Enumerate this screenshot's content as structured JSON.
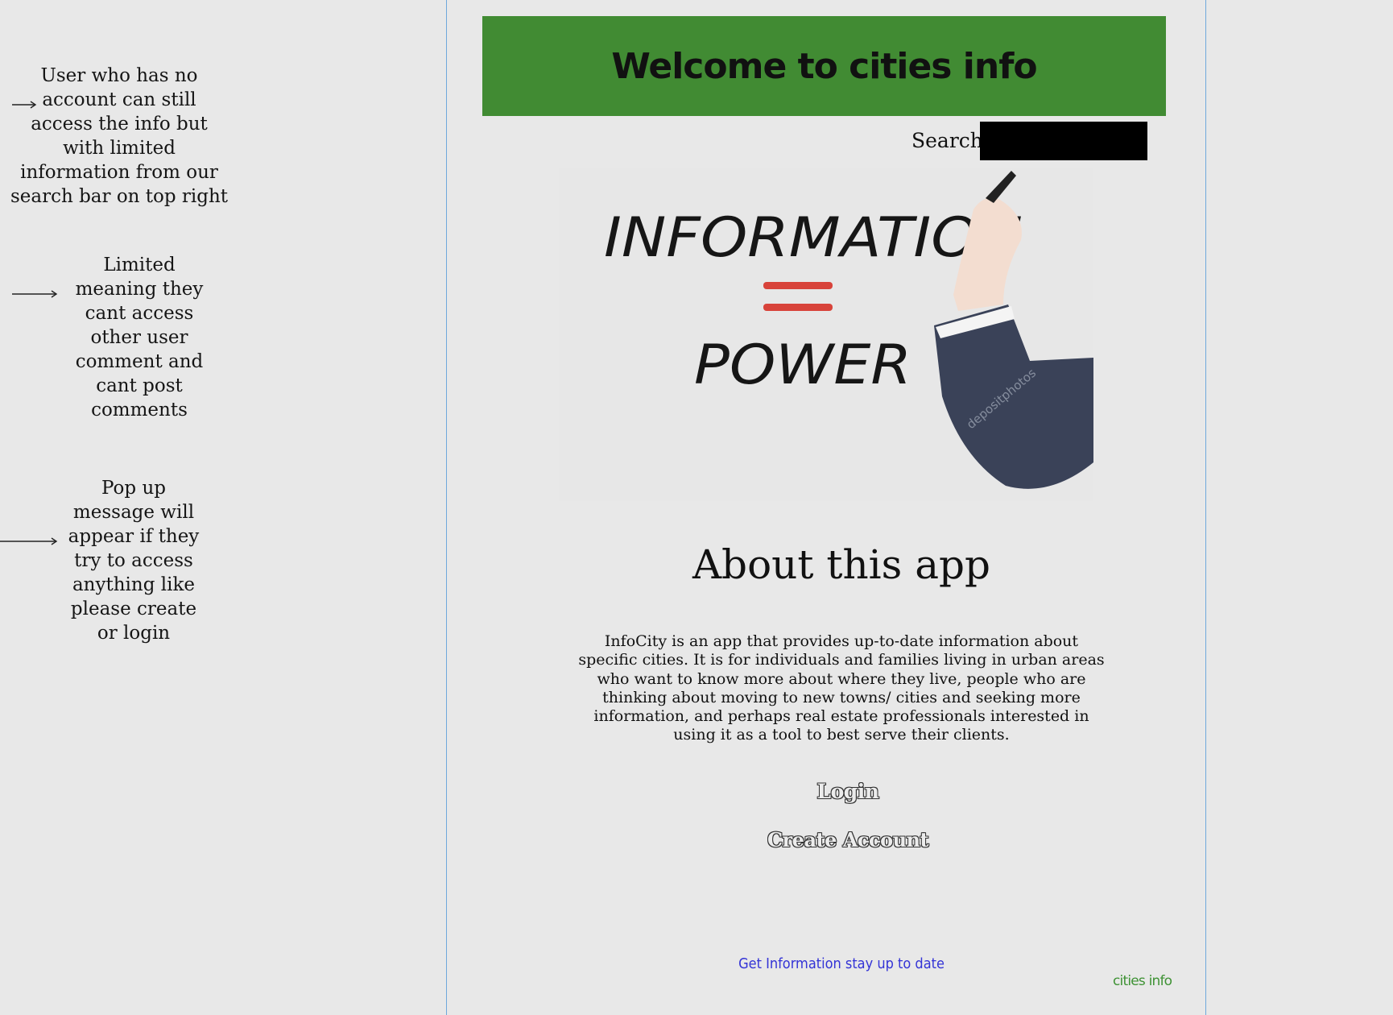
{
  "annotations": [
    "User who has no account can still access the info but with limited information from our search bar on top right",
    "Limited meaning they cant access other user comment and cant post comments",
    "Pop up message will appear if they try to access anything like please create or login"
  ],
  "header": {
    "title": "Welcome to cities info"
  },
  "search": {
    "label": "Search:",
    "value": ""
  },
  "hero": {
    "line1": "INFORMATION",
    "line2": "POWER",
    "watermark": "depositphotos"
  },
  "about": {
    "title": "About this app",
    "text": "InfoCity is an app that provides up-to-date information about specific cities. It is for individuals and families living in urban areas who want to know more about where they live, people who are thinking about moving to new towns/ cities and seeking more information, and perhaps real estate professionals interested in using it as a tool to best serve their clients."
  },
  "actions": {
    "login": "Login",
    "create_account": "Create Account"
  },
  "footer": {
    "link": "Get Information stay up to date",
    "brand": "cities info"
  },
  "colors": {
    "header_bg": "#418b33",
    "brand": "#3e9234",
    "footer_link": "#3434d6",
    "frame_line": "#6fa8dc",
    "background": "#e8e8e8"
  }
}
